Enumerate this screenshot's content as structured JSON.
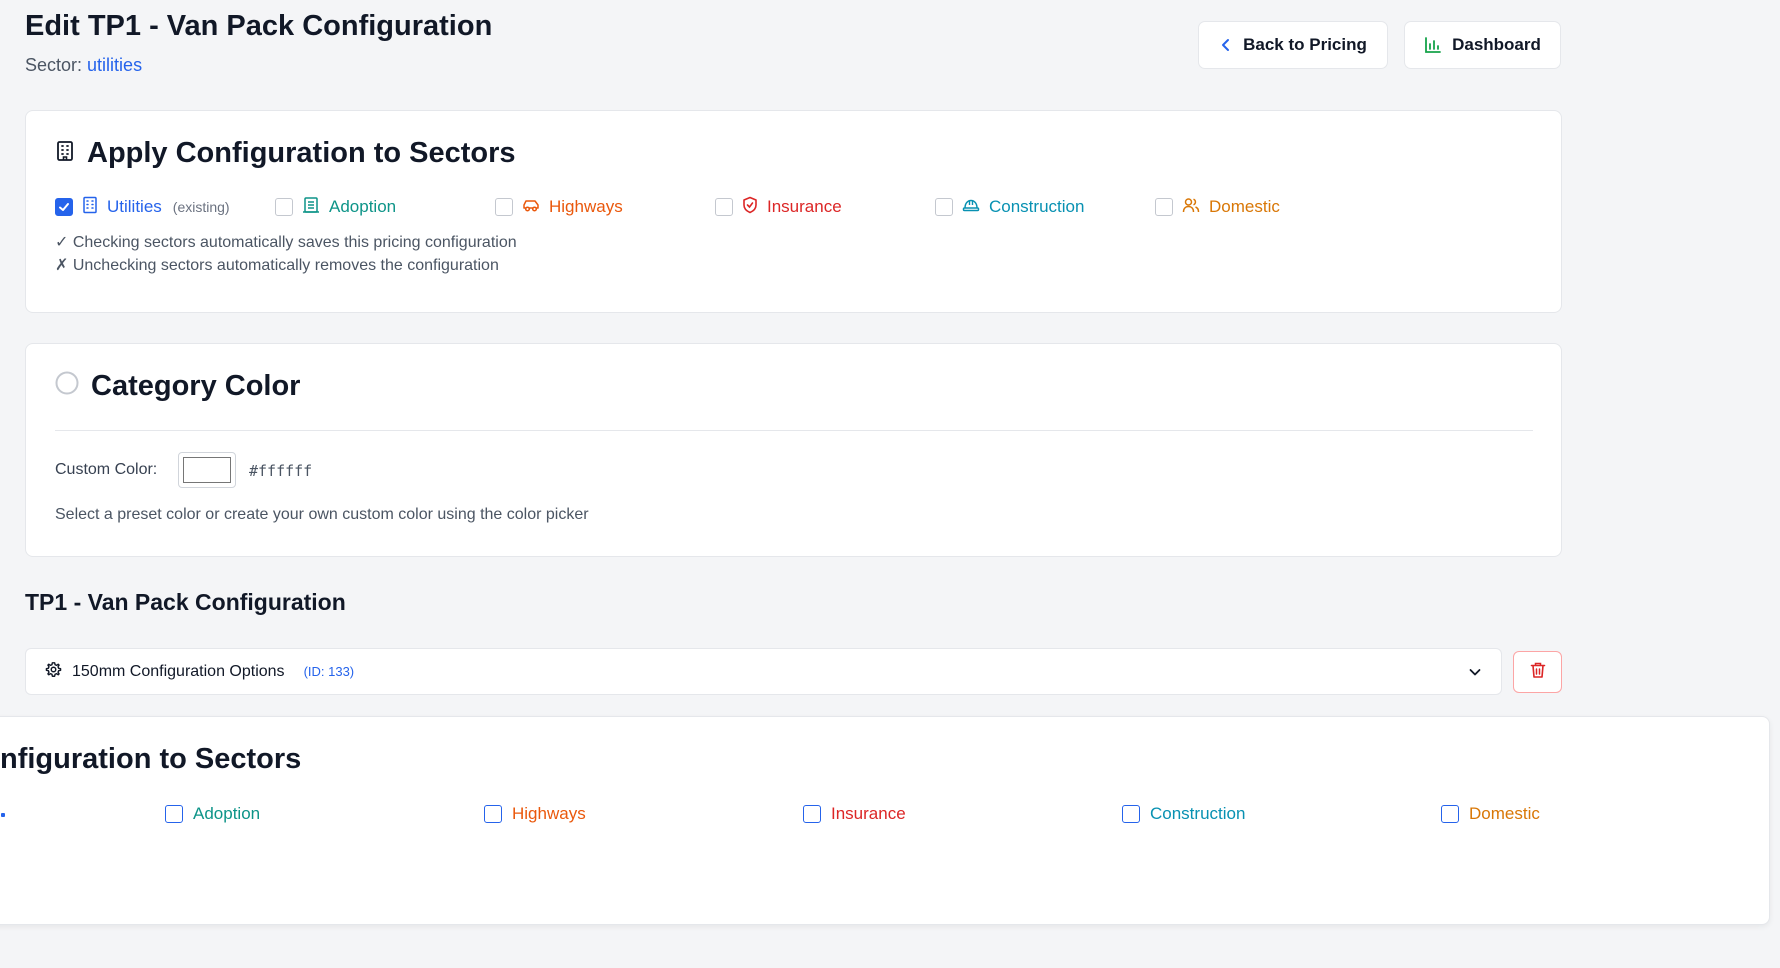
{
  "header": {
    "title": "Edit TP1 - Van Pack Configuration",
    "sector_label": "Sector:",
    "sector_value": "utilities",
    "back_button": "Back to Pricing",
    "dashboard_button": "Dashboard"
  },
  "apply_sectors": {
    "title": "Apply Configuration to Sectors",
    "items": [
      {
        "label": "Utilities",
        "suffix": "(existing)",
        "checked": true,
        "icon": "building-icon",
        "color": "#2563eb"
      },
      {
        "label": "Adoption",
        "checked": false,
        "icon": "building-columns-icon",
        "color": "#0d9488"
      },
      {
        "label": "Highways",
        "checked": false,
        "icon": "car-icon",
        "color": "#ea580c"
      },
      {
        "label": "Insurance",
        "checked": false,
        "icon": "shield-icon",
        "color": "#dc2626"
      },
      {
        "label": "Construction",
        "checked": false,
        "icon": "hard-hat-icon",
        "color": "#0891b2"
      },
      {
        "label": "Domestic",
        "checked": false,
        "icon": "users-icon",
        "color": "#d97706"
      }
    ],
    "notes": [
      "✓ Checking sectors automatically saves this pricing configuration",
      "✗ Unchecking sectors automatically removes the configuration"
    ]
  },
  "category_color": {
    "title": "Category Color",
    "custom_label": "Custom Color:",
    "value": "#ffffff",
    "help": "Select a preset color or create your own custom color using the color picker"
  },
  "config_section": {
    "title": "TP1 - Van Pack Configuration",
    "accordion_label": "150mm Configuration Options",
    "accordion_id": "(ID: 133)"
  },
  "overlay": {
    "title": "nfiguration to Sectors",
    "items": [
      {
        "label": "Adoption",
        "color": "#0d9488"
      },
      {
        "label": "Highways",
        "color": "#ea580c"
      },
      {
        "label": "Insurance",
        "color": "#dc2626"
      },
      {
        "label": "Construction",
        "color": "#0891b2"
      },
      {
        "label": "Domestic",
        "color": "#d97706"
      }
    ]
  }
}
